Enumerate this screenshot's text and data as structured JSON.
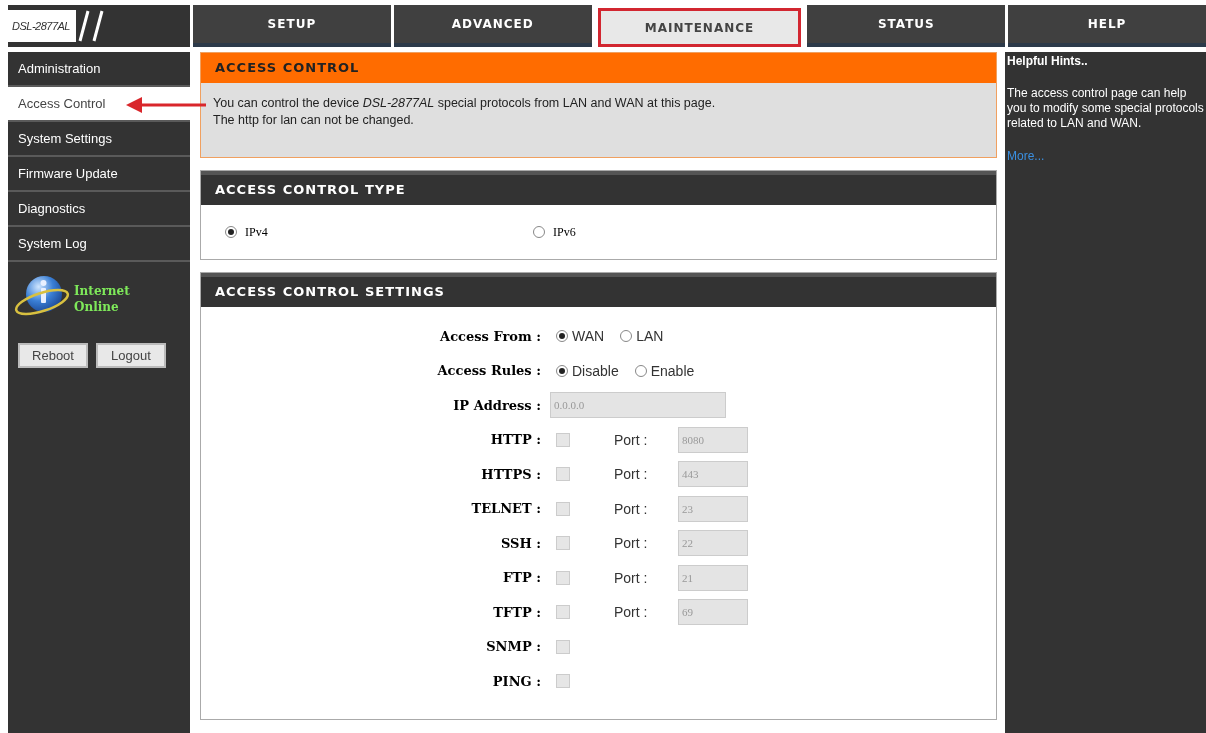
{
  "logo": {
    "text": "DSL-2877AL"
  },
  "tabs": [
    {
      "label": "SETUP",
      "selected": false
    },
    {
      "label": "ADVANCED",
      "selected": false
    },
    {
      "label": "MAINTENANCE",
      "selected": true
    },
    {
      "label": "STATUS",
      "selected": false
    },
    {
      "label": "HELP",
      "selected": false
    }
  ],
  "sidebar": {
    "items": [
      {
        "label": "Administration",
        "selected": false
      },
      {
        "label": "Access Control",
        "selected": true
      },
      {
        "label": "System Settings",
        "selected": false
      },
      {
        "label": "Firmware Update",
        "selected": false
      },
      {
        "label": "Diagnostics",
        "selected": false
      },
      {
        "label": "System Log",
        "selected": false
      }
    ],
    "status": {
      "line1": "Internet",
      "line2": "Online"
    },
    "buttons": [
      "Reboot",
      "Logout"
    ]
  },
  "intro": {
    "title": "ACCESS CONTROL",
    "text": "You can control the device *DSL-2877AL* special protocols from LAN and WAN at this page.",
    "text2": "The http for lan can not be changed."
  },
  "type_section": {
    "title": "ACCESS CONTROL TYPE",
    "options": [
      {
        "label": "IPv4",
        "selected": true
      },
      {
        "label": "IPv6",
        "selected": false
      }
    ]
  },
  "settings": {
    "title": "ACCESS CONTROL SETTINGS",
    "rows": [
      {
        "kind": "radio",
        "label": "Access From :",
        "options": [
          {
            "label": "WAN",
            "selected": true
          },
          {
            "label": "LAN",
            "selected": false
          }
        ]
      },
      {
        "kind": "radio",
        "label": "Access Rules :",
        "options": [
          {
            "label": "Disable",
            "selected": true
          },
          {
            "label": "Enable",
            "selected": false
          }
        ]
      },
      {
        "kind": "text",
        "label": "IP Address :",
        "value": "0.0.0.0",
        "disabled": true
      },
      {
        "kind": "port",
        "label": "HTTP :",
        "checked": false,
        "disabled": true,
        "port_label": "Port :",
        "port": "8080"
      },
      {
        "kind": "port",
        "label": "HTTPS :",
        "checked": false,
        "disabled": true,
        "port_label": "Port :",
        "port": "443"
      },
      {
        "kind": "port",
        "label": "TELNET :",
        "checked": false,
        "disabled": true,
        "port_label": "Port :",
        "port": "23"
      },
      {
        "kind": "port",
        "label": "SSH :",
        "checked": false,
        "disabled": true,
        "port_label": "Port :",
        "port": "22"
      },
      {
        "kind": "port",
        "label": "FTP :",
        "checked": false,
        "disabled": true,
        "port_label": "Port :",
        "port": "21"
      },
      {
        "kind": "port",
        "label": "TFTP :",
        "checked": false,
        "disabled": true,
        "port_label": "Port :",
        "port": "69"
      },
      {
        "kind": "check",
        "label": "SNMP :",
        "checked": false,
        "disabled": true
      },
      {
        "kind": "check",
        "label": "PING :",
        "checked": false,
        "disabled": true
      }
    ]
  },
  "hints": {
    "title": "Helpful Hints..",
    "text": "The access control page can help you to modify some special protocols related to LAN and WAN.",
    "link": "More..."
  }
}
